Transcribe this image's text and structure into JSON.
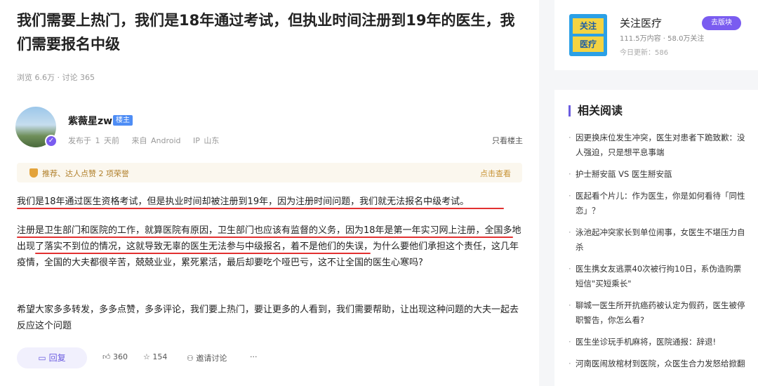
{
  "post": {
    "title": "我们需要上热门，我们是18年通过考试，但执业时间注册到19年的医生，我们需要报名中级",
    "meta": "浏览 6.6万 · 讨论 365",
    "author": {
      "name": "紫薇星zw",
      "badge": "楼主",
      "published": "发布于 1 天前",
      "source": "来自 Android",
      "ip": "IP 山东"
    },
    "only_op": "只看楼主",
    "honor": {
      "text": "推荐、达人点赞 2 项荣誉",
      "link": "点击查看"
    },
    "paragraphs": [
      "我们是18年通过医生资格考试，但是执业时间却被注册到19年，因为注册时间问题，我们就无法报名中级考试。",
      "注册是卫生部门和医院的工作，就算医院有原因，卫生部门也应该有监督的义务，因为18年是第一年实习网上注册，全国多地出现了落实不到位的情况，这就导致无辜的医生无法参与中级报名，着不是他们的失误，为什么要他们承担这个责任，这几年疫情，全国的大夫都很辛苦，兢兢业业，累死累活，最后却要吃个哑巴亏，这不让全国的医生心寒吗?",
      "希望大家多多转发，多多点赞，多多评论，我们要上热门，要让更多的人看到，我们需要帮助，让出现这种问题的大夫一起去反应这个问题"
    ],
    "actions": {
      "reply": "回复",
      "likes": "360",
      "favorites": "154",
      "invite": "邀请讨论",
      "more": "···"
    }
  },
  "sidebar": {
    "board": {
      "logo_line1": "关注",
      "logo_line2": "医疗",
      "name": "关注医疗",
      "stats": "111.5万内容 · 58.0万关注",
      "update": "今日更新：586",
      "button": "去版块"
    },
    "related": {
      "heading": "相关阅读",
      "items": [
        "因更换床位发生冲突，医生对患者下跪致歉：没人强迫，只是想平息事端",
        "护士掰安瓿 VS 医生掰安瓿",
        "医起看个片儿：作为医生，你是如何看待「同性恋」？",
        "泳池起冲突家长到单位闹事，女医生不堪压力自杀",
        "医生携女友逃票40次被行拘10日，系伪造购票短信\"买短乘长\"",
        "聊城一医生所开抗癌药被认定为假药，医生被停职警告，你怎么看?",
        "医生坐诊玩手机麻将，医院通报：辞退!",
        "河南医闹放棺材到医院，众医生合力发怒给掀翻"
      ]
    }
  },
  "colors": {
    "accent": "#7a5cf0",
    "underline": "#e23131",
    "op_badge": "#4e8df5"
  }
}
